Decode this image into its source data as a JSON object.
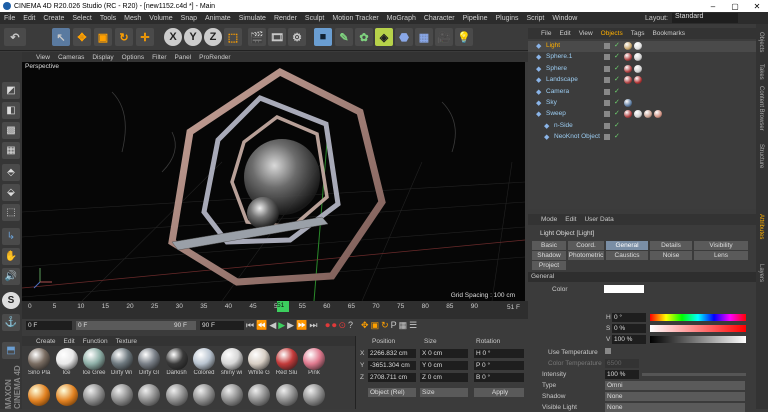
{
  "window": {
    "title": "CINEMA 4D R20.026 Studio (RC - R20) - [new1152.c4d *] - Main"
  },
  "menu": [
    "File",
    "Edit",
    "Create",
    "Select",
    "Tools",
    "Mesh",
    "Volume",
    "Snap",
    "Animate",
    "Simulate",
    "Render",
    "Sculpt",
    "Motion Tracker",
    "MoGraph",
    "Character",
    "Pipeline",
    "Plugins",
    "Script",
    "Window"
  ],
  "layout": {
    "label": "Layout:",
    "value": "Standard"
  },
  "viewport": {
    "menu": [
      "View",
      "Cameras",
      "Display",
      "Options",
      "Filter",
      "Panel",
      "ProRender"
    ],
    "label": "Perspective",
    "grid_spacing": "Grid Spacing : 100 cm"
  },
  "timeline": {
    "ticks": [
      "0",
      "5",
      "10",
      "15",
      "20",
      "25",
      "30",
      "35",
      "40",
      "45",
      "50",
      "55",
      "60",
      "65",
      "70",
      "75",
      "80",
      "85",
      "90"
    ],
    "current_frame": "51",
    "end_label": "51 F",
    "fields": {
      "start": "0 F",
      "min": "0 F",
      "max": "90 F",
      "end": "90 F"
    }
  },
  "materials": {
    "menu": [
      "Create",
      "Edit",
      "Function",
      "Texture"
    ],
    "items": [
      {
        "name": "Sino Pla",
        "color": "#7a6d62"
      },
      {
        "name": "Ice",
        "color": "#e8e8e8"
      },
      {
        "name": "Ice Gree",
        "color": "#8fb0a8"
      },
      {
        "name": "Dirty Wi",
        "color": "#6f7a80"
      },
      {
        "name": "Dirty Gl",
        "color": "#7a8088"
      },
      {
        "name": "Darkish",
        "color": "#3a3a3a"
      },
      {
        "name": "Colored",
        "color": "#b9c4d0"
      },
      {
        "name": "shiny wi",
        "color": "#d6d6d6"
      },
      {
        "name": "White G",
        "color": "#d8cfc5"
      },
      {
        "name": "Red Slu",
        "color": "#c43b3b"
      },
      {
        "name": "Pink",
        "color": "#e07a8f"
      }
    ]
  },
  "coords": {
    "headers": [
      "Position",
      "Size",
      "Rotation"
    ],
    "rows": [
      {
        "axis": "X",
        "pos": "2266.832 cm",
        "size": "X 0 cm",
        "rot": "H 0 °"
      },
      {
        "axis": "Y",
        "pos": "-3651.304 cm",
        "size": "Y 0 cm",
        "rot": "P 0 °"
      },
      {
        "axis": "Z",
        "pos": "2708.711 cm",
        "size": "Z 0 cm",
        "rot": "B 0 °"
      }
    ],
    "mode": "Object (Rel)",
    "size_mode": "Size",
    "apply": "Apply"
  },
  "objects": {
    "tabs": [
      "File",
      "Edit",
      "View",
      "Objects",
      "Tags",
      "Bookmarks"
    ],
    "active_tab": "Objects",
    "rows": [
      {
        "name": "Light",
        "indent": 0,
        "hl": true,
        "tags": [
          "#c9a56a",
          "#e0e0e0"
        ]
      },
      {
        "name": "Sphere.1",
        "indent": 0,
        "tags": [
          "#b04040",
          "#d0d0d0"
        ]
      },
      {
        "name": "Sphere",
        "indent": 0,
        "tags": [
          "#b04040",
          "#d0d0d0"
        ]
      },
      {
        "name": "Landscape",
        "indent": 0,
        "tags": [
          "#b04040",
          "#b03030"
        ]
      },
      {
        "name": "Camera",
        "indent": 0,
        "tags": []
      },
      {
        "name": "Sky",
        "indent": 0,
        "tags": [
          "#5a7aa0"
        ]
      },
      {
        "name": "Sweep",
        "indent": 0,
        "tags": [
          "#b04040",
          "#d0d0d0",
          "#c9a090",
          "#d09080"
        ]
      },
      {
        "name": "n-Side",
        "indent": 1,
        "tags": []
      },
      {
        "name": "NeoKnot Object",
        "indent": 1,
        "tags": []
      }
    ]
  },
  "attributes": {
    "menu": [
      "Mode",
      "Edit",
      "User Data"
    ],
    "title": "Light Object [Light]",
    "tabs": [
      "Basic",
      "Coord.",
      "General",
      "Details",
      "Visibility",
      "Shadow",
      "Photometric",
      "Caustics",
      "Noise",
      "Lens",
      "Project"
    ],
    "active_tab": "General",
    "section": "General",
    "color_label": "Color",
    "h": "0 °",
    "s": "0 %",
    "v": "100 %",
    "use_temp": "Use Temperature",
    "color_temp": "Color Temperature",
    "color_temp_val": "6500",
    "intensity_label": "Intensity",
    "intensity": "100 %",
    "type_label": "Type",
    "type": "Omni",
    "shadow_label": "Shadow",
    "shadow": "None",
    "visible_label": "Visible Light",
    "visible": "None"
  },
  "right_strip": [
    "Objects",
    "Takes",
    "Content Browser",
    "Structure",
    "Attributes",
    "Layers"
  ]
}
